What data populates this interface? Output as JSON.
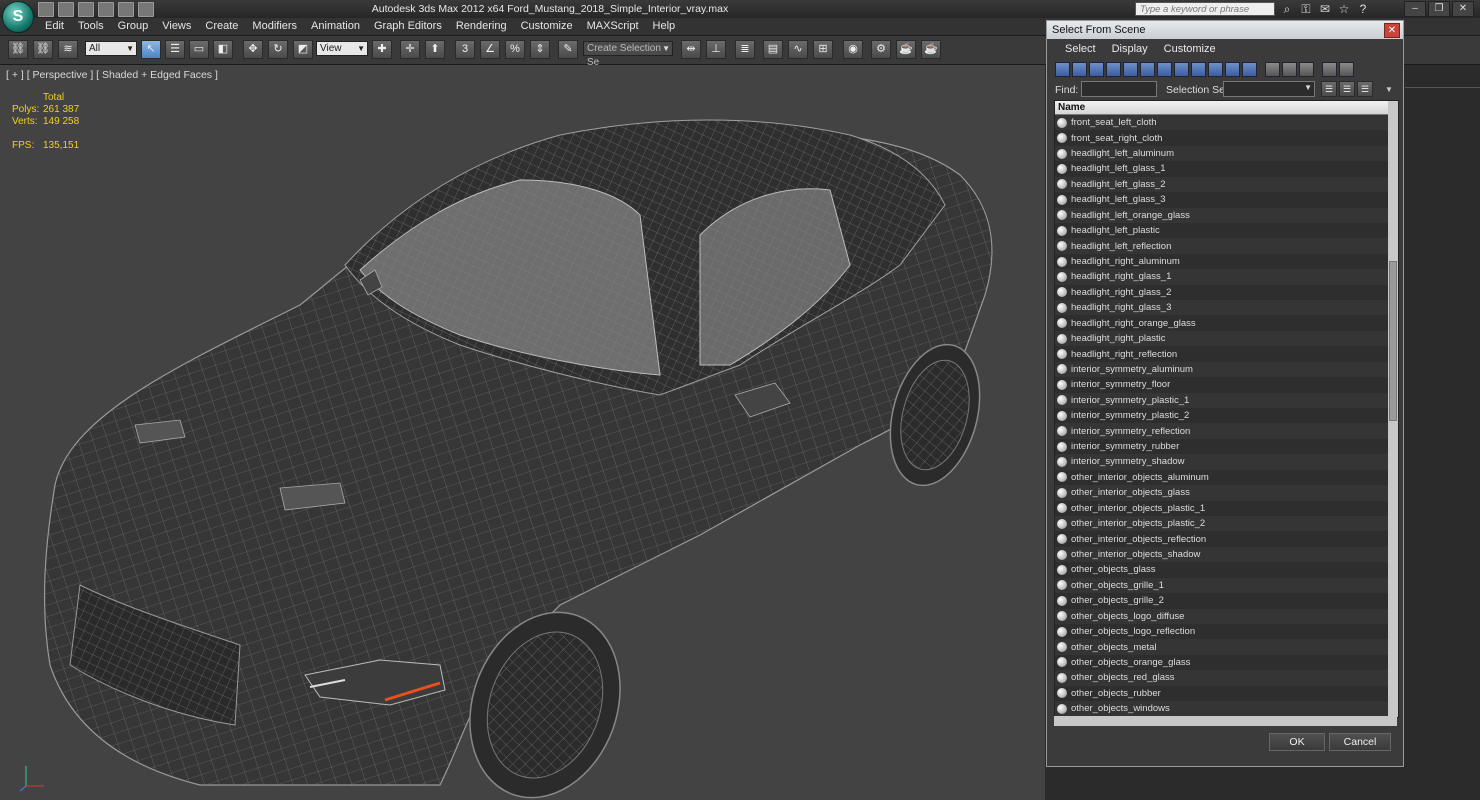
{
  "app": {
    "logo_text": "S",
    "title": "Autodesk 3ds Max  2012 x64      Ford_Mustang_2018_Simple_Interior_vray.max",
    "search_placeholder": "Type a keyword or phrase"
  },
  "menu": [
    "Edit",
    "Tools",
    "Group",
    "Views",
    "Create",
    "Modifiers",
    "Animation",
    "Graph Editors",
    "Rendering",
    "Customize",
    "MAXScript",
    "Help"
  ],
  "toolbar": {
    "filter_value": "All",
    "refcoord_value": "View",
    "selection_set_placeholder": "Create Selection Se"
  },
  "viewport": {
    "label": "[ + ] [ Perspective ] [ Shaded + Edged Faces ]",
    "stats": {
      "total_label": "Total",
      "polys_label": "Polys:",
      "polys_value": "261 387",
      "verts_label": "Verts:",
      "verts_value": "149 258",
      "fps_label": "FPS:",
      "fps_value": "135,151"
    }
  },
  "dialog": {
    "title": "Select From Scene",
    "close_glyph": "✕",
    "menu": [
      "Select",
      "Display",
      "Customize"
    ],
    "find_label": "Find:",
    "selection_set_label": "Selection Set:",
    "column_name": "Name",
    "items": [
      "front_seat_left_cloth",
      "front_seat_right_cloth",
      "headlight_left_aluminum",
      "headlight_left_glass_1",
      "headlight_left_glass_2",
      "headlight_left_glass_3",
      "headlight_left_orange_glass",
      "headlight_left_plastic",
      "headlight_left_reflection",
      "headlight_right_aluminum",
      "headlight_right_glass_1",
      "headlight_right_glass_2",
      "headlight_right_glass_3",
      "headlight_right_orange_glass",
      "headlight_right_plastic",
      "headlight_right_reflection",
      "interior_symmetry_aluminum",
      "interior_symmetry_floor",
      "interior_symmetry_plastic_1",
      "interior_symmetry_plastic_2",
      "interior_symmetry_reflection",
      "interior_symmetry_rubber",
      "interior_symmetry_shadow",
      "other_interior_objects_aluminum",
      "other_interior_objects_glass",
      "other_interior_objects_plastic_1",
      "other_interior_objects_plastic_2",
      "other_interior_objects_reflection",
      "other_interior_objects_shadow",
      "other_objects_glass",
      "other_objects_grille_1",
      "other_objects_grille_2",
      "other_objects_logo_diffuse",
      "other_objects_logo_reflection",
      "other_objects_metal",
      "other_objects_orange_glass",
      "other_objects_red_glass",
      "other_objects_rubber",
      "other_objects_windows"
    ],
    "ok_label": "OK",
    "cancel_label": "Cancel"
  },
  "colors": {
    "stats_yellow": "#f0d020",
    "viewport_bg": "#434343",
    "headlight_orange": "#e85020"
  }
}
